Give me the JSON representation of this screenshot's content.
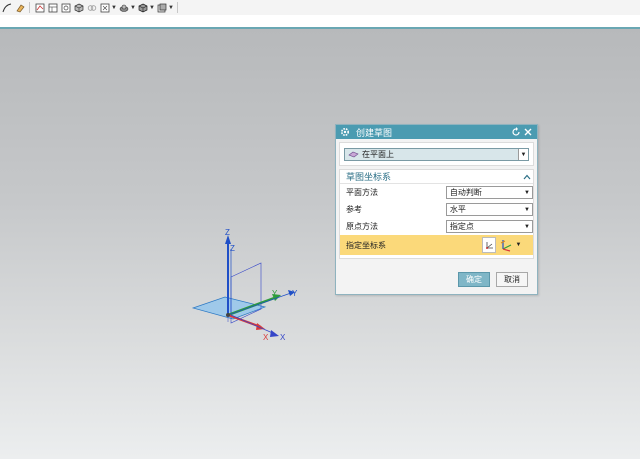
{
  "toolbar": {
    "icons": [
      "curve-icon",
      "eraser-icon",
      "sketch-icon",
      "table-icon",
      "copy-icon",
      "box-icon",
      "link-icon",
      "view-icon",
      "shell-icon",
      "cube-icon",
      "layer-icon"
    ]
  },
  "viewport": {
    "triad": {
      "labels": {
        "z_primary": "Z",
        "z_secondary": "Z",
        "y_primary": "Y",
        "y_secondary": "Y",
        "x_primary": "X",
        "x_secondary": "X"
      },
      "colors": {
        "z": "#1f4fc7",
        "y": "#2e9e3b",
        "x": "#d83a3a",
        "plane": "#7fb6e6"
      }
    }
  },
  "dialog": {
    "title": "创建草图",
    "type_value": "在平面上",
    "section_title": "草图坐标系",
    "rows": [
      {
        "label": "平面方法",
        "value": "自动判断"
      },
      {
        "label": "参考",
        "value": "水平"
      },
      {
        "label": "原点方法",
        "value": "指定点"
      }
    ],
    "highlight_label": "指定坐标系",
    "ok_label": "确定",
    "cancel_label": "取消",
    "colors": {
      "title_bar": "#4b9bb1",
      "highlight": "#fbd97a",
      "section_text": "#2b6f86"
    }
  }
}
